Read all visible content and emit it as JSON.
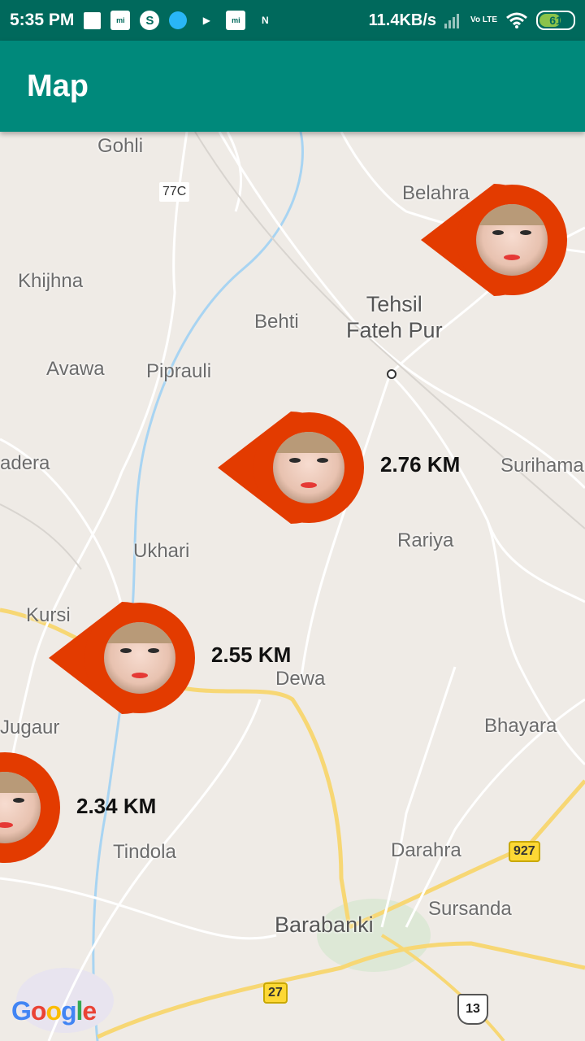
{
  "status_bar": {
    "time": "5:35 PM",
    "network_speed": "11.4KB/s",
    "volte_label": "Vo LTE",
    "battery_level": "61"
  },
  "app_bar": {
    "title": "Map"
  },
  "map": {
    "places": [
      {
        "name": "Gohli"
      },
      {
        "name": "Belahra"
      },
      {
        "name": "Khijhna"
      },
      {
        "name": "Behti"
      },
      {
        "name": "Tehsil\nFateh Pur"
      },
      {
        "name": "Avawa"
      },
      {
        "name": "Piprauli"
      },
      {
        "name": "adera"
      },
      {
        "name": "Surihamau"
      },
      {
        "name": "Rariya"
      },
      {
        "name": "Ukhari"
      },
      {
        "name": "Kursi"
      },
      {
        "name": "Dewa"
      },
      {
        "name": "Jugaur"
      },
      {
        "name": "Bhayara"
      },
      {
        "name": "Tindola"
      },
      {
        "name": "Darahra"
      },
      {
        "name": "Sursanda"
      },
      {
        "name": "Barabanki"
      }
    ],
    "road_shields": {
      "r77c": "77C",
      "r927": "927",
      "r27": "27",
      "r13": "13"
    },
    "attribution": "Google"
  },
  "markers": [
    {
      "distance": "2.76 KM"
    },
    {
      "distance": "2.55 KM"
    },
    {
      "distance": "2.34 KM"
    },
    {
      "distance": ""
    }
  ]
}
